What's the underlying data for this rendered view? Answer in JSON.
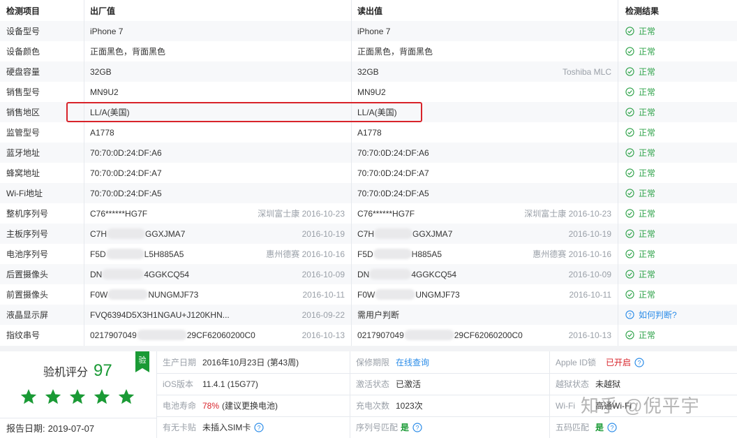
{
  "header": {
    "col_item": "检测项目",
    "col_factory": "出厂值",
    "col_read": "读出值",
    "col_result": "检测结果"
  },
  "rows": [
    {
      "item": "设备型号",
      "factory": "iPhone 7",
      "factory_extra": "",
      "read": "iPhone 7",
      "read_extra": "",
      "result": "正常",
      "result_type": "ok"
    },
    {
      "item": "设备颜色",
      "factory": "正面黑色，背面黑色",
      "factory_extra": "",
      "read": "正面黑色，背面黑色",
      "read_extra": "",
      "result": "正常",
      "result_type": "ok"
    },
    {
      "item": "硬盘容量",
      "factory": "32GB",
      "factory_extra": "",
      "read": "32GB",
      "read_extra": "Toshiba MLC",
      "result": "正常",
      "result_type": "ok"
    },
    {
      "item": "销售型号",
      "factory": "MN9U2",
      "factory_extra": "",
      "read": "MN9U2",
      "read_extra": "",
      "result": "正常",
      "result_type": "ok"
    },
    {
      "item": "销售地区",
      "factory": "LL/A(美国)",
      "factory_extra": "",
      "read": "LL/A(美国)",
      "read_extra": "",
      "result": "正常",
      "result_type": "ok"
    },
    {
      "item": "监管型号",
      "factory": "A1778",
      "factory_extra": "",
      "read": "A1778",
      "read_extra": "",
      "result": "正常",
      "result_type": "ok"
    },
    {
      "item": "蓝牙地址",
      "factory": "70:70:0D:24:DF:A6",
      "factory_extra": "",
      "read": "70:70:0D:24:DF:A6",
      "read_extra": "",
      "result": "正常",
      "result_type": "ok"
    },
    {
      "item": "蜂窝地址",
      "factory": "70:70:0D:24:DF:A7",
      "factory_extra": "",
      "read": "70:70:0D:24:DF:A7",
      "read_extra": "",
      "result": "正常",
      "result_type": "ok"
    },
    {
      "item": "Wi-Fi地址",
      "factory": "70:70:0D:24:DF:A5",
      "factory_extra": "",
      "read": "70:70:0D:24:DF:A5",
      "read_extra": "",
      "result": "正常",
      "result_type": "ok"
    },
    {
      "item": "整机序列号",
      "factory": "C76******HG7F",
      "factory_extra": "深圳富士康  2016-10-23",
      "read": "C76******HG7F",
      "read_extra": "深圳富士康  2016-10-23",
      "result": "正常",
      "result_type": "ok"
    },
    {
      "item": "主板序列号",
      "factory_pre": "C7H",
      "factory_post": "GGXJMA7",
      "factory_extra": "2016-10-19",
      "read_pre": "C7H",
      "read_post": "GGXJMA7",
      "read_extra": "2016-10-19",
      "result": "正常",
      "result_type": "ok"
    },
    {
      "item": "电池序列号",
      "factory_pre": "F5D",
      "factory_post": "L5H885A5",
      "factory_extra": "惠州德赛  2016-10-16",
      "read_pre": "F5D",
      "read_post": "H885A5",
      "read_extra": "惠州德赛  2016-10-16",
      "result": "正常",
      "result_type": "ok"
    },
    {
      "item": "后置摄像头",
      "factory_pre": "DN",
      "factory_post": "4GGKCQ54",
      "factory_extra": "2016-10-09",
      "read_pre": "DN",
      "read_post": "4GGKCQ54",
      "read_extra": "2016-10-09",
      "result": "正常",
      "result_type": "ok"
    },
    {
      "item": "前置摄像头",
      "factory_pre": "F0W",
      "factory_post": "NUNGMJF73",
      "factory_extra": "2016-10-11",
      "read_pre": "F0W",
      "read_post": "UNGMJF73",
      "read_extra": "2016-10-11",
      "result": "正常",
      "result_type": "ok"
    },
    {
      "item": "液晶显示屏",
      "factory": "FVQ6394D5X3H1NGAU+J120KHN...",
      "factory_extra": "2016-09-22",
      "read": "需用户判断",
      "read_extra": "",
      "result": "如何判断?",
      "result_type": "question"
    },
    {
      "item": "指纹串号",
      "factory_pre": "0217907049",
      "factory_post": "29CF62060200C0",
      "factory_extra": "2016-10-13",
      "read_pre": "0217907049",
      "read_post": "29CF62060200C0",
      "read_extra": "2016-10-13",
      "result": "正常",
      "result_type": "ok"
    }
  ],
  "summary": {
    "score_label": "验机评分",
    "score": "97",
    "stars": 5,
    "ribbon": "验",
    "report_date_label": "报告日期:",
    "report_date": "2019-07-07",
    "production_date_label": "生产日期",
    "production_date": "2016年10月23日 (第43周)",
    "warranty_label": "保修期限",
    "warranty_link": "在线查询",
    "appleid_label": "Apple ID锁",
    "appleid_value": "已开启",
    "ios_label": "iOS版本",
    "ios_value": "11.4.1 (15G77)",
    "activation_label": "激活状态",
    "activation_value": "已激活",
    "jailbreak_label": "越狱状态",
    "jailbreak_value": "未越狱",
    "battery_label": "电池寿命",
    "battery_pct": "78%",
    "battery_note": "(建议更换电池)",
    "charge_label": "充电次数",
    "charge_value": "1023次",
    "wifi_label": "Wi-Fi",
    "wifi_value": "高通Wi-Fi",
    "sim_label": "有无卡贴",
    "sim_value": "未插入SIM卡",
    "serial_match_label": "序列号匹配",
    "serial_match_value": "是",
    "fivecode_label": "五码匹配",
    "fivecode_value": "是"
  },
  "watermark": "知乎 @倪平宇",
  "colors": {
    "ok_green": "#2fa34a",
    "accent_green": "#1a9a35",
    "alert_red": "#d8232a",
    "link_blue": "#2b8ce8"
  }
}
